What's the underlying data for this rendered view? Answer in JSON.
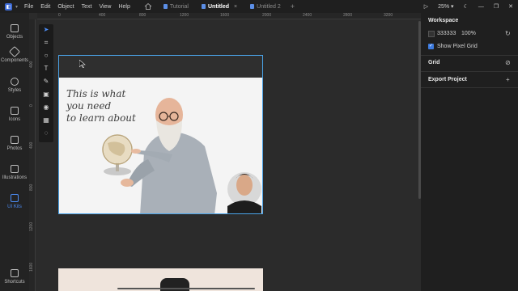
{
  "menu": [
    "File",
    "Edit",
    "Object",
    "Text",
    "View",
    "Help"
  ],
  "tabs": [
    {
      "label": "Tutorial",
      "active": false
    },
    {
      "label": "Untitled",
      "active": true
    },
    {
      "label": "Untitled 2",
      "active": false
    }
  ],
  "tab_close": "×",
  "tab_add": "+",
  "zoom": "25%",
  "left_nav": [
    {
      "label": "Objects"
    },
    {
      "label": "Components"
    },
    {
      "label": "Styles"
    },
    {
      "label": "Icons"
    },
    {
      "label": "Photos"
    },
    {
      "label": "Illustrations"
    },
    {
      "label": "UI Kits"
    },
    {
      "label": "Shortcuts"
    }
  ],
  "ruler_top": [
    "0",
    "400",
    "800",
    "1200",
    "1600",
    "2000",
    "2400",
    "2800",
    "3200"
  ],
  "ruler_left": [
    "400",
    "0",
    "400",
    "800",
    "1200",
    "1600"
  ],
  "hero_lines": [
    "This is what",
    "you need",
    "to learn about"
  ],
  "right_panel": {
    "workspace_title": "Workspace",
    "workspace_color": "333333",
    "workspace_opacity": "100%",
    "show_pixel_grid": "Show Pixel Grid",
    "grid_title": "Grid",
    "export_title": "Export Project",
    "export_add": "+"
  },
  "colors": {
    "accent": "#4c8df6",
    "selection": "#4aa3e8",
    "canvas": "#2b2b2b"
  }
}
